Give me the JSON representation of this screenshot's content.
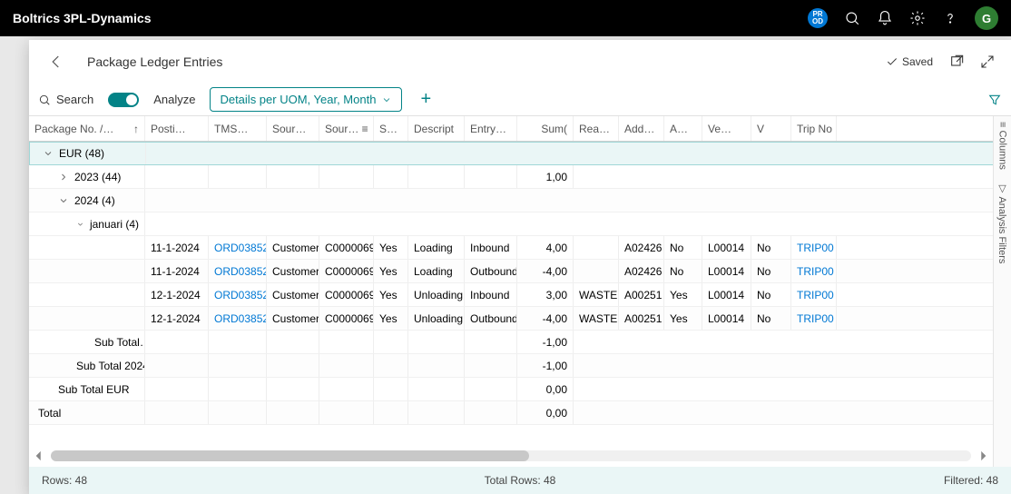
{
  "brand": "Boltrics 3PL-Dynamics",
  "prod_badge": "PR\nOD",
  "avatar_letter": "G",
  "page_title": "Package Ledger Entries",
  "saved_label": "Saved",
  "search_label": "Search",
  "analyze_label": "Analyze",
  "view_label": "Details per UOM, Year, Month",
  "columns": [
    "Package No. /…",
    "Posti…",
    "TMS…",
    "Sour…",
    "Sour… ≡",
    "S…",
    "Descript",
    "Entry…",
    "Sum(",
    "Rea…",
    "Add…",
    "A…",
    "Ve…",
    "V",
    "Trip No"
  ],
  "group_eur": "EUR (48)",
  "group_2023": "2023 (44)",
  "group_2024": "2024 (4)",
  "group_jan": "januari (4)",
  "sum_2023": "1,00",
  "rows": [
    {
      "date": "11-1-2024",
      "tms": "ORD03852",
      "srcType": "Customer",
      "srcNo": "C0000069",
      "s": "Yes",
      "desc": "Loading",
      "entry": "Inbound",
      "sum": "4,00",
      "rea": "",
      "add": "A02426",
      "a": "No",
      "ve": "L00014",
      "v": "No",
      "trip": "TRIP00"
    },
    {
      "date": "11-1-2024",
      "tms": "ORD03852",
      "srcType": "Customer",
      "srcNo": "C0000069",
      "s": "Yes",
      "desc": "Loading",
      "entry": "Outbound",
      "sum": "-4,00",
      "rea": "",
      "add": "A02426",
      "a": "No",
      "ve": "L00014",
      "v": "No",
      "trip": "TRIP00"
    },
    {
      "date": "12-1-2024",
      "tms": "ORD03852",
      "srcType": "Customer",
      "srcNo": "C0000069",
      "s": "Yes",
      "desc": "Unloading",
      "entry": "Inbound",
      "sum": "3,00",
      "rea": "WASTE",
      "add": "A00251",
      "a": "Yes",
      "ve": "L00014",
      "v": "No",
      "trip": "TRIP00"
    },
    {
      "date": "12-1-2024",
      "tms": "ORD03852",
      "srcType": "Customer",
      "srcNo": "C0000069",
      "s": "Yes",
      "desc": "Unloading",
      "entry": "Outbound",
      "sum": "-4,00",
      "rea": "WASTE",
      "add": "A00251",
      "a": "Yes",
      "ve": "L00014",
      "v": "No",
      "trip": "TRIP00"
    }
  ],
  "subtotals": [
    {
      "label": "Sub Total…",
      "val": "-1,00",
      "indent": "indent3"
    },
    {
      "label": "Sub Total 2024",
      "val": "-1,00",
      "indent": "indent2"
    },
    {
      "label": "Sub Total EUR",
      "val": "0,00",
      "indent": "indent1"
    }
  ],
  "total_label": "Total",
  "total_val": "0,00",
  "side_tabs": [
    "≡ Columns",
    "▽ Analysis Filters"
  ],
  "footer_rows": "Rows: 48",
  "footer_total": "Total Rows: 48",
  "footer_filtered": "Filtered: 48"
}
